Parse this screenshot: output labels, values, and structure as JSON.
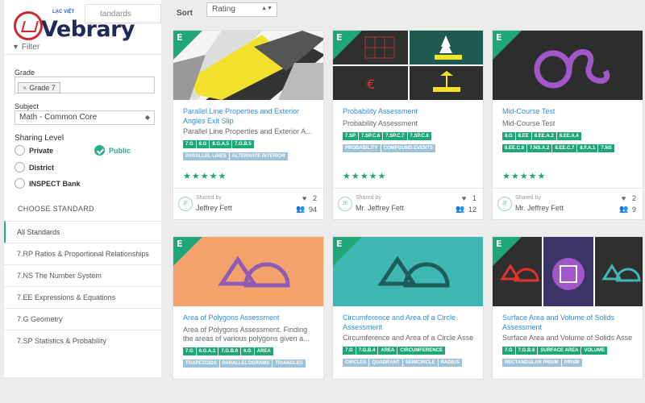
{
  "sidebar": {
    "standards_search_text": "tandards",
    "logo_small": "LẠC VIỆT",
    "logo_text": "Vebrary",
    "filter_label": "Filter",
    "grade_label": "Grade",
    "grade_chip": "Grade 7",
    "subject_label": "Subject",
    "subject_value": "Math - Common Core",
    "sharing_label": "Sharing Level",
    "sharing_options": [
      "Private",
      "Public",
      "District",
      "INSPECT Bank"
    ],
    "sharing_selected": "Public",
    "choose_standard": "CHOOSE STANDARD",
    "standards": [
      "All Standards",
      "7.RP Ratios & Proportional Relationships",
      "7.NS The Number System",
      "7.EE Expressions & Equations",
      "7.G Geometry",
      "7.SP Statistics & Probability"
    ]
  },
  "toolbar": {
    "sort_label": "Sort",
    "sort_value": "Rating"
  },
  "colors": {
    "accent": "#1fa67a",
    "link": "#2a8fd6",
    "tag_blue": "#9dc3dc"
  },
  "cards": [
    {
      "title": "Parallel Line Properties and Exterior Angles Exit Slip",
      "subtitle": "Parallel Line Properties and Exterior A...",
      "tags_green": [
        "7.G",
        "8.G",
        "8.G.A.5",
        "7.G.B.5"
      ],
      "tags_blue": [
        "PARALLEL LINES",
        "ALTERNATE INTERIOR"
      ],
      "stars": "★★★★★",
      "shared_by": "Shared by",
      "owner": "Jeffrey Fett",
      "initials": "JF",
      "likes": "2",
      "users": "94"
    },
    {
      "title": "Probability Assessment",
      "subtitle": "Probability Assessment",
      "tags_green": [
        "7.SP",
        "7.SP.C.6",
        "7.SP.C.7",
        "7.SP.C.8"
      ],
      "tags_blue": [
        "PROBABILITY",
        "COMPOUND EVENTS"
      ],
      "stars": "★★★★★",
      "shared_by": "Shared by",
      "owner": "Mr. Jeffrey Fett",
      "initials": "JF",
      "likes": "1",
      "users": "12"
    },
    {
      "title": "Mid-Course Test",
      "subtitle": "Mid-Course Test",
      "tags_green": [
        "8.G",
        "8.EE",
        "8.EE.A.2",
        "8.EE.A.4",
        "8.EE.C.8",
        "7.NS.A.2",
        "8.EE.C.7",
        "8.F.A.1",
        "7.NS"
      ],
      "tags_blue": [],
      "stars": "★★★★★",
      "shared_by": "Shared by",
      "owner": "Mr. Jeffrey Fett",
      "initials": "JF",
      "likes": "2",
      "users": "9"
    },
    {
      "title": "Area of Polygons Assessment",
      "subtitle": "Area of Polygons Assessment. Finding the areas of various polygons given a...",
      "tags_green": [
        "7.G",
        "6.G.A.1",
        "7.G.B.6",
        "6.G",
        "AREA"
      ],
      "tags_blue": [
        "TRAPEZOIDS",
        "PARALLELOGRAMS",
        "TRIANGLES"
      ]
    },
    {
      "title": "Circumference and Area of a Circle Assessment",
      "subtitle": "Circumference and Area of a Circle Asse...",
      "tags_green": [
        "7.G",
        "7.G.B.4",
        "AREA",
        "CIRCUMFERENCE"
      ],
      "tags_blue": [
        "CIRCLES",
        "QUADRANT",
        "SEMICIRCLE",
        "RADIUS"
      ]
    },
    {
      "title": "Surface Area and Volume of Solids Assessment",
      "subtitle": "Surface Area and Volume of Solids Asse...",
      "tags_green": [
        "7.G",
        "7.G.B.6",
        "SURFACE AREA",
        "VOLUME"
      ],
      "tags_blue": [
        "RECTANGULAR PRISM",
        "PRISM"
      ]
    }
  ],
  "card_flag_letter": "E"
}
